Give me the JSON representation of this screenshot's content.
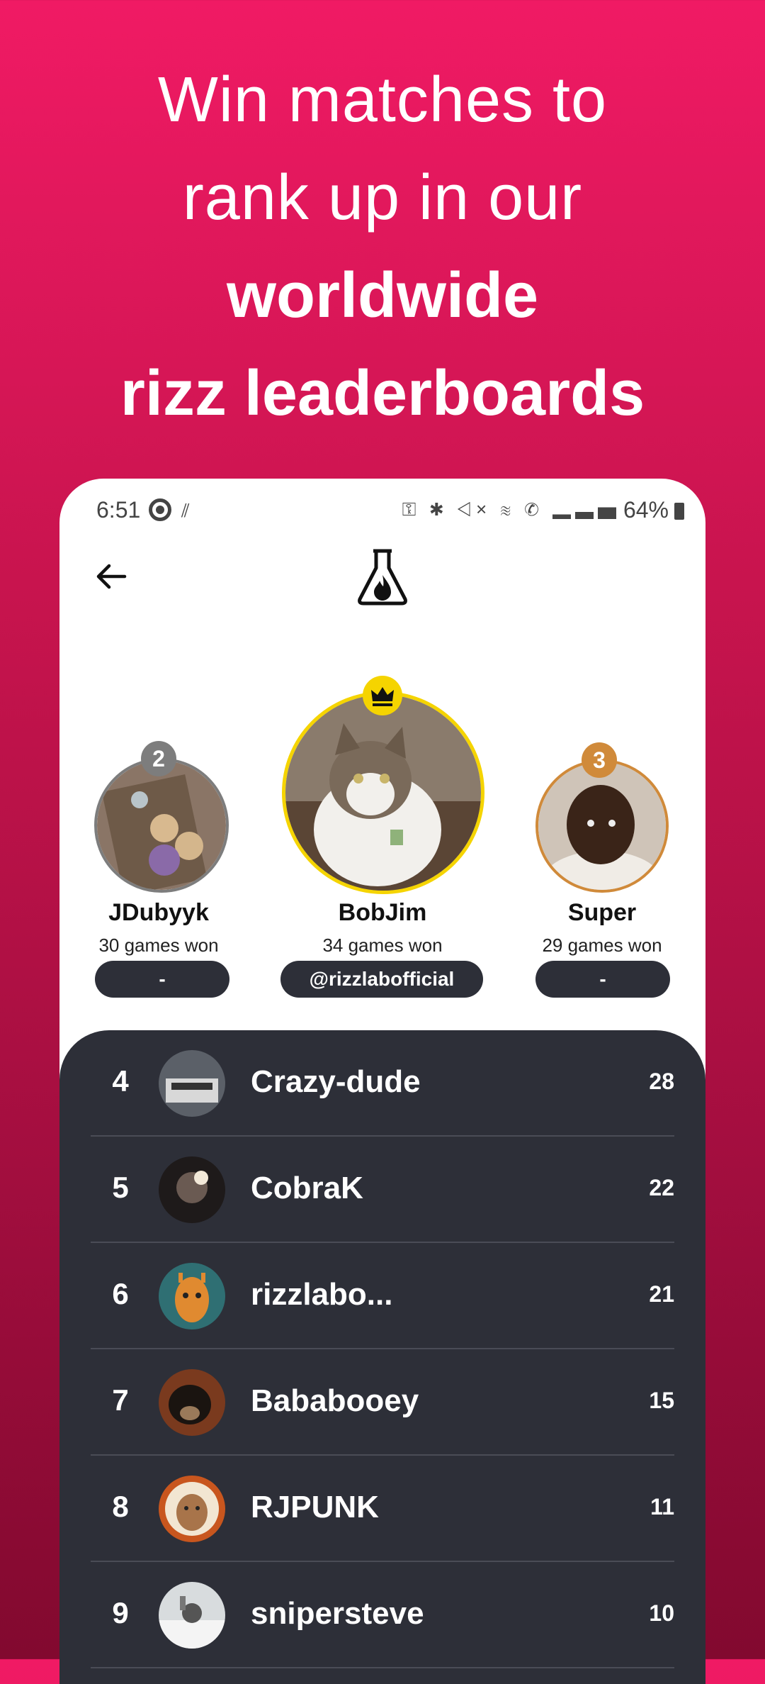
{
  "headline": {
    "line1": "Win matches to",
    "line2": "rank up in our",
    "line3": "worldwide",
    "line4": "rizz leaderboards"
  },
  "status_bar": {
    "time": "6:51",
    "icons": "⚿ ✱ ◁× ≋ ✆ ▂▃▅",
    "battery": "64%"
  },
  "header": {
    "back_icon": "arrow-left-icon",
    "logo_icon": "flask-flame-icon"
  },
  "podium": {
    "first": {
      "rank": "",
      "name": "BobJim",
      "games": "34 games won",
      "handle": "@rizzlabofficial",
      "crown_icon": "crown-icon",
      "ring_color": "#f5d400"
    },
    "second": {
      "rank": "2",
      "name": "JDubyyk",
      "games": "30 games won",
      "handle": "-",
      "ring_color": "#7d7d7d"
    },
    "third": {
      "rank": "3",
      "name": "Super",
      "games": "29 games won",
      "handle": "-",
      "ring_color": "#d08a3a"
    }
  },
  "leaderboard": [
    {
      "rank": "4",
      "name": "Crazy-dude",
      "score": "28"
    },
    {
      "rank": "5",
      "name": "CobraK",
      "score": "22"
    },
    {
      "rank": "6",
      "name": "rizzlabo...",
      "score": "21"
    },
    {
      "rank": "7",
      "name": "Bababooey",
      "score": "15"
    },
    {
      "rank": "8",
      "name": "RJPUNK",
      "score": "11"
    },
    {
      "rank": "9",
      "name": "snipersteve",
      "score": "10"
    }
  ],
  "colors": {
    "brand_pink": "#f01a64",
    "panel_dark": "#2d2f38"
  }
}
